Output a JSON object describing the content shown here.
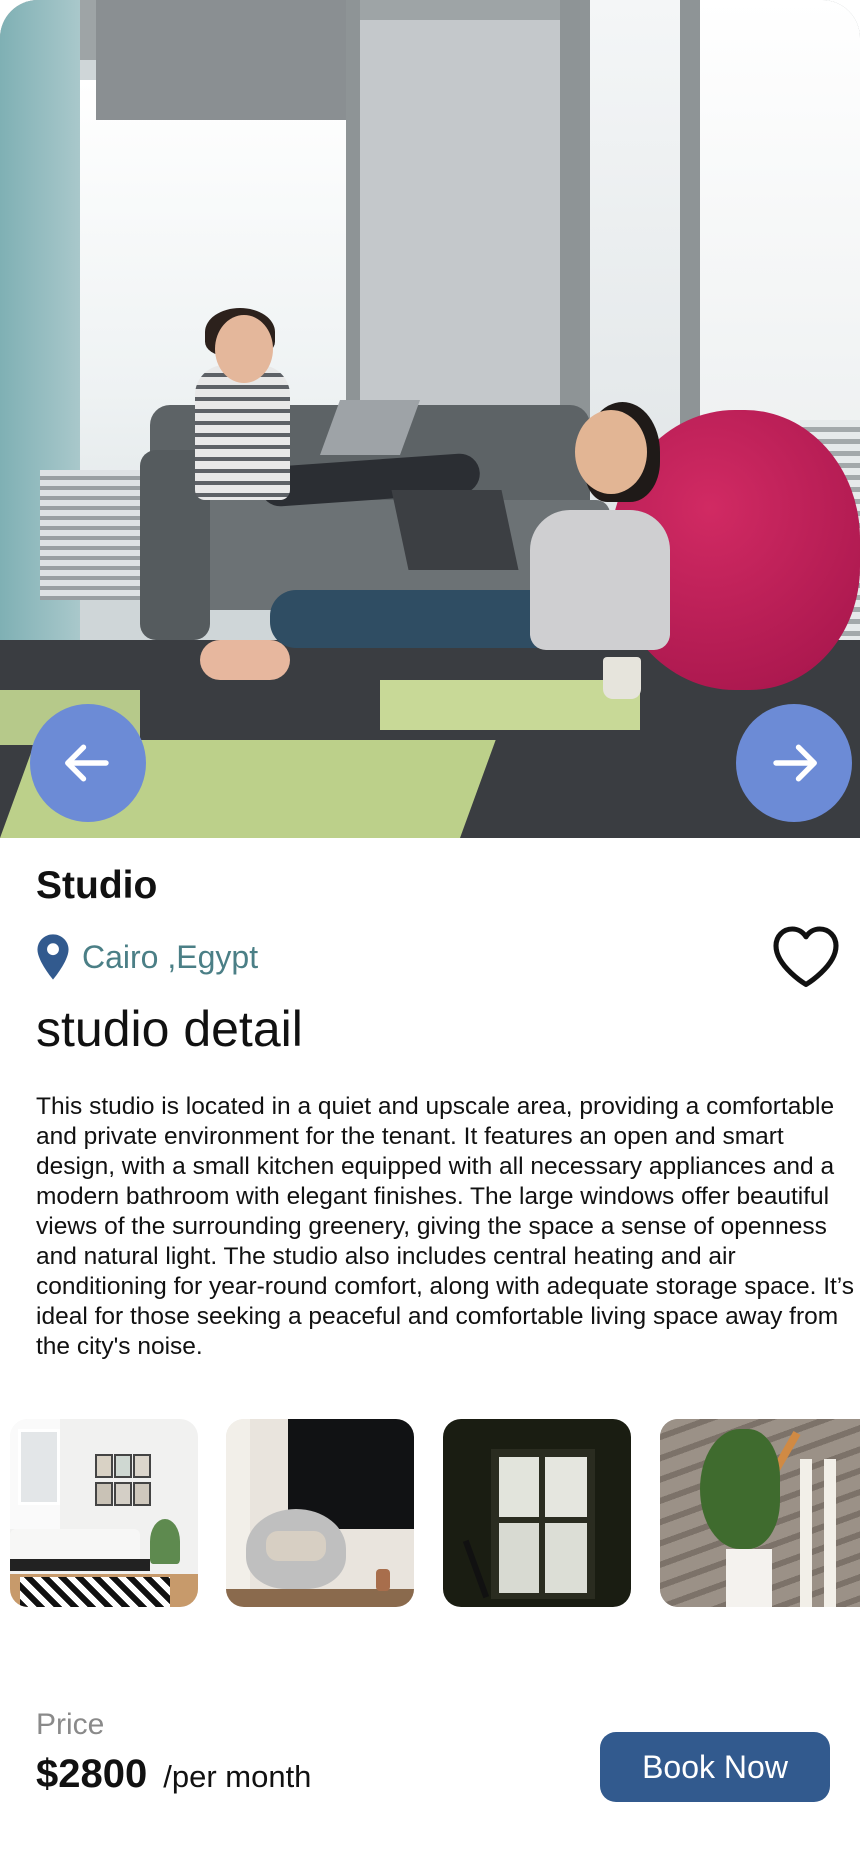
{
  "listing": {
    "title": "Studio",
    "location": "Cairo ,Egypt",
    "detail_heading": "studio detail",
    "description": "This studio is located in a quiet and upscale area, providing a comfortable and private environment for the tenant. It features an open and smart design, with a small kitchen equipped with all necessary appliances and a modern bathroom with elegant finishes. The large windows offer beautiful views of the surrounding greenery, giving the space a sense of openness and natural light. The studio also includes central heating and air conditioning for year-round comfort, along with adequate storage space. It’s ideal for those seeking a peaceful and comfortable living space away from the city's noise."
  },
  "hero": {
    "prev_icon": "arrow-left-icon",
    "next_icon": "arrow-right-icon"
  },
  "icons": {
    "location": "map-pin-icon",
    "favorite": "heart-outline-icon"
  },
  "footer": {
    "price_label": "Price",
    "price_value": "$2800",
    "price_unit": "/per month",
    "book_label": "Book Now"
  },
  "colors": {
    "accent": "#325a8e",
    "nav_arrow": "#6c8bd6",
    "location_text": "#4b7f86",
    "price_label": "#8a8a8a"
  }
}
